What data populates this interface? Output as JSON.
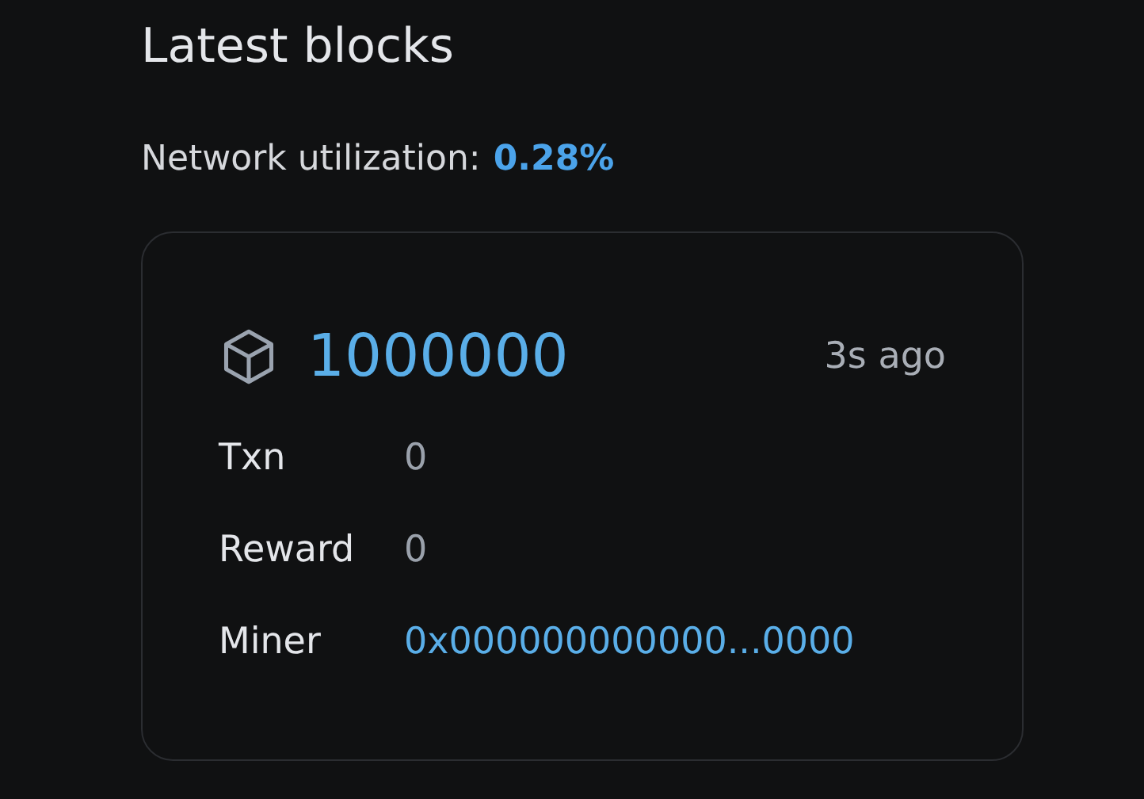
{
  "title": "Latest blocks",
  "utilization": {
    "label": "Network utilization:",
    "value": "0.28%"
  },
  "block": {
    "number": "1000000",
    "age": "3s ago",
    "rows": [
      {
        "label": "Txn",
        "value": "0",
        "kind": "text"
      },
      {
        "label": "Reward",
        "value": "0",
        "kind": "text"
      },
      {
        "label": "Miner",
        "value": "0x000000000000...0000",
        "kind": "link"
      }
    ]
  }
}
